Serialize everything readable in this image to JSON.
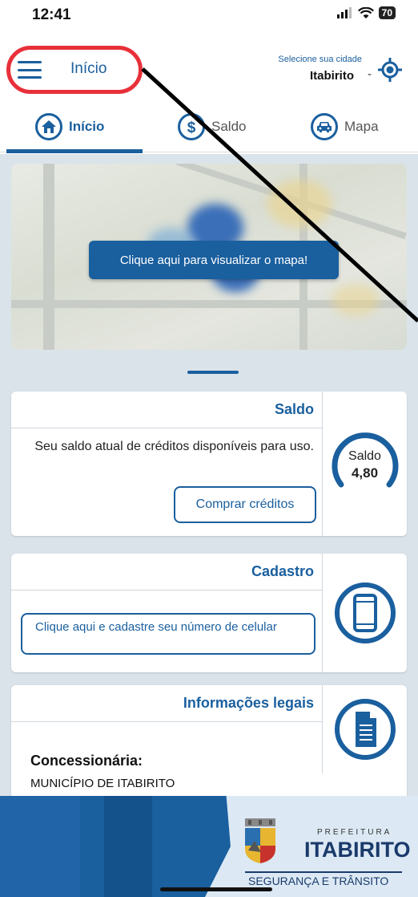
{
  "status": {
    "time": "12:41",
    "battery": "70"
  },
  "header": {
    "title": "Início",
    "city_prompt": "Selecione sua cidade",
    "city": "Itabirito",
    "dash": "-"
  },
  "tabs": [
    {
      "label": "Início",
      "active": true
    },
    {
      "label": "Saldo",
      "active": false
    },
    {
      "label": "Mapa",
      "active": false
    }
  ],
  "map": {
    "button_label": "Clique aqui para visualizar o mapa!"
  },
  "saldo": {
    "title": "Saldo",
    "description": "Seu saldo atual de créditos disponíveis para uso.",
    "buy_label": "Comprar créditos",
    "gauge_label": "Saldo",
    "gauge_value": "4,80"
  },
  "cadastro": {
    "title": "Cadastro",
    "button_label": "Clique aqui e cadastre seu número de celular"
  },
  "legal": {
    "title": "Informações legais",
    "subtitle": "Concessionária:",
    "value": "MUNICÍPIO DE ITABIRITO"
  },
  "footer": {
    "pref_label": "PREFEITURA",
    "pref_name": "ITABIRITO",
    "dept": "SEGURANÇA E TRÂNSITO"
  },
  "colors": {
    "primary": "#1a5f9e",
    "highlight": "#e8303a",
    "background": "#dbe3ea"
  }
}
